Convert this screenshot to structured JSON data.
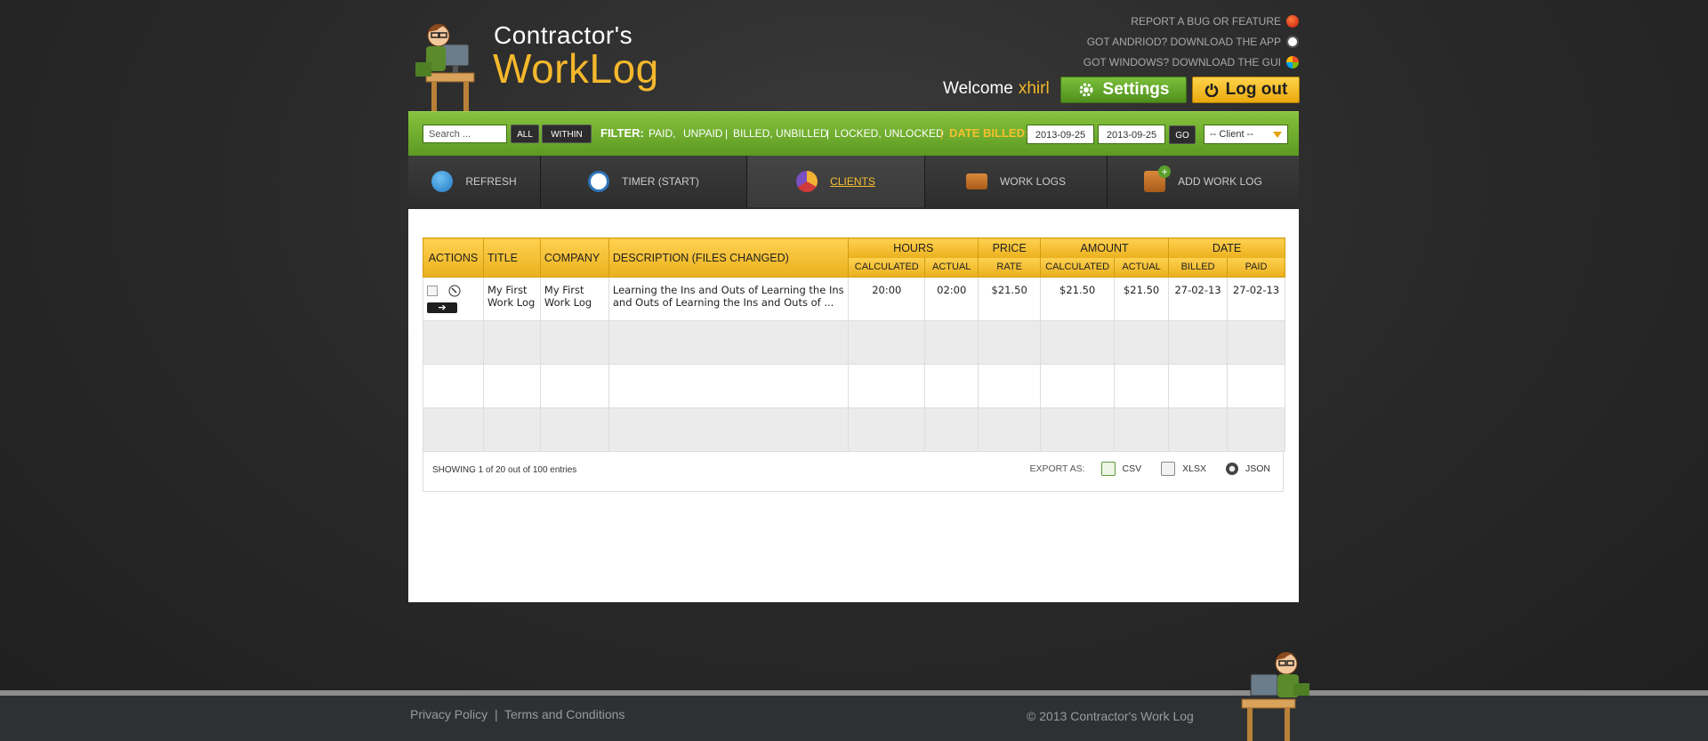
{
  "header": {
    "logo_line1": "Contractor's",
    "logo_line2": "WorkLog",
    "links": [
      {
        "label": "REPORT A BUG OR FEATURE",
        "icon": "bug-icon"
      },
      {
        "label": "GOT ANDRIOD?  DOWNLOAD THE APP",
        "icon": "android-icon"
      },
      {
        "label": "GOT WINDOWS?  DOWNLOAD THE GUI",
        "icon": "windows-icon"
      }
    ],
    "welcome": "Welcome",
    "username": "xhirl",
    "settings_label": "Settings",
    "logout_label": "Log out"
  },
  "filter": {
    "search_placeholder": "Search ...",
    "all_label": "ALL",
    "within_label": "WITHIN",
    "filter_label": "FILTER:",
    "opt_paid": "PAID,",
    "opt_unpaid": "UNPAID",
    "sep1": "|",
    "opt_billed": "BILLED, UNBILLED",
    "sep2": "|",
    "opt_locked": "LOCKED, UNLOCKED",
    "sep3": "|",
    "date_billed_label": "DATE BILLED:",
    "date_from": "2013-09-25",
    "date_to": "2013-09-25",
    "go_label": "GO",
    "client_select": "-- Client --"
  },
  "nav": {
    "tabs": [
      {
        "label": "REFRESH"
      },
      {
        "label": "TIMER (START)"
      },
      {
        "label": "CLIENTS"
      },
      {
        "label": "WORK LOGS"
      },
      {
        "label": "ADD WORK LOG"
      }
    ],
    "active": "CLIENTS"
  },
  "table": {
    "headers": {
      "actions": "ACTIONS",
      "title": "TITLE",
      "company": "COMPANY",
      "description": "DESCRIPTION (FILES CHANGED)",
      "hours": "HOURS",
      "hours_calc": "CALCULATED",
      "hours_actual": "ACTUAL",
      "price": "PRICE",
      "price_rate": "RATE",
      "amount": "AMOUNT",
      "amount_calc": "CALCULATED",
      "amount_actual": "ACTUAL",
      "date": "DATE",
      "date_billed": "BILLED",
      "date_paid": "PAID"
    },
    "rows": [
      {
        "title": "My First Work Log",
        "company": "My First Work Log",
        "description": "Learning the Ins and Outs of Learning the Ins and Outs of Learning the Ins and Outs of ...",
        "hours_calc": "20:00",
        "hours_actual": "02:00",
        "rate": "$21.50",
        "amount_calc": "$21.50",
        "amount_actual": "$21.50",
        "billed": "27-02-13",
        "paid": "27-02-13"
      }
    ],
    "showing": "SHOWING 1 of 20 out of 100 entries",
    "export_label": "EXPORT AS:",
    "export_csv": "CSV",
    "export_xlsx": "XLSX",
    "export_json": "JSON"
  },
  "footer": {
    "privacy": "Privacy Policy",
    "sep": "|",
    "terms": "Terms and Conditions",
    "copyright": "© 2013 Contractor's Work Log"
  },
  "colors": {
    "accent_yellow": "#f5b82c",
    "green": "#6aa82b",
    "dark": "#2a2a2a"
  }
}
